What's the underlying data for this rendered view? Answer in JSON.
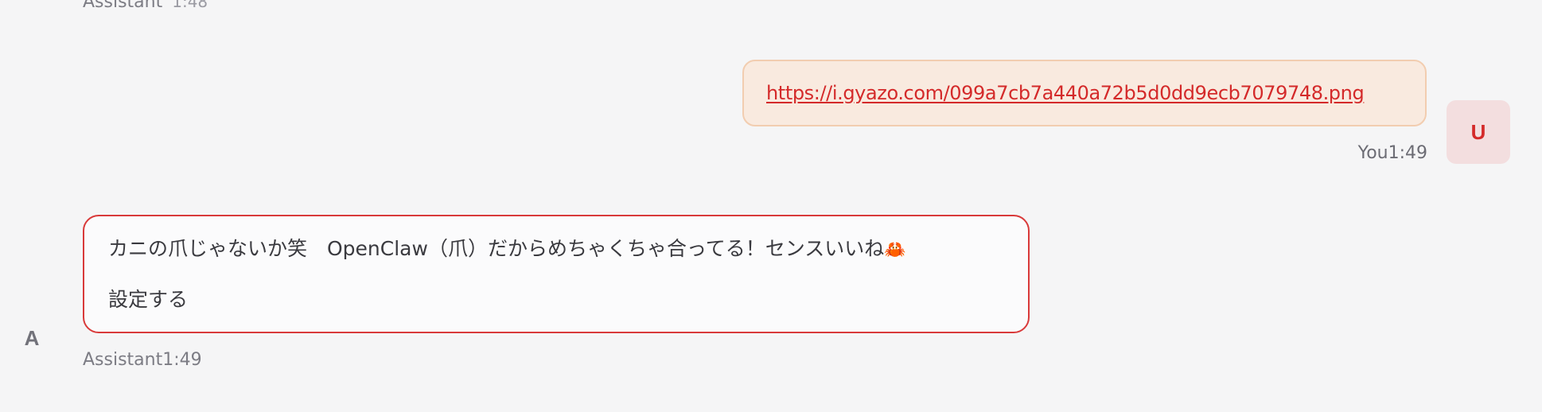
{
  "previous_message": {
    "sender": "Assistant",
    "time": "1:48"
  },
  "user_message": {
    "link_text": "https://i.gyazo.com/099a7cb7a440a72b5d0dd9ecb7079748.png",
    "sender": "You",
    "time": "1:49",
    "avatar_initial": "U"
  },
  "assistant_message": {
    "line1": "カニの爪じゃないか笑　OpenClaw（爪）だからめちゃくちゃ合ってる！センスいいね",
    "line1_emoji": "🦀",
    "line2": "設定する",
    "sender": "Assistant",
    "time": "1:49",
    "avatar_initial": "A"
  },
  "colors": {
    "background": "#f5f5f6",
    "user_bubble": "#f9eadf",
    "user_bubble_border": "#f2cdb0",
    "link": "#d42a2a",
    "assistant_border": "#d93a3a",
    "user_avatar_bg": "#f3dedf"
  }
}
